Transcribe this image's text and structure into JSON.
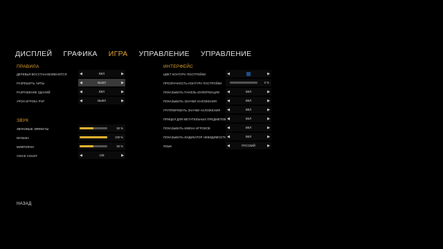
{
  "tabs": [
    "ДИСПЛЕЙ",
    "ГРАФИКА",
    "ИГРА",
    "УПРАВЛЕНИЕ",
    "УПРАВЛЕНИЕ"
  ],
  "active_tab_index": 2,
  "accent_color": "#e8a934",
  "rules": {
    "title": "ПРАВИЛА",
    "items": [
      {
        "label": "ДЕРЕВЬЯ ВОССТАНАВЛИВАЮТСЯ",
        "value": "ВКЛ"
      },
      {
        "label": "РАЗРЕШИТЬ ЧИТЫ",
        "value": "ВЫКЛ"
      },
      {
        "label": "РАЗРУШЕНИЕ ЗДАНИЙ",
        "value": "ВКЛ"
      },
      {
        "label": "УРОН ИГРОКА PVP",
        "value": "ВЫКЛ"
      }
    ]
  },
  "sound": {
    "title": "ЗВУК",
    "items": [
      {
        "label": "ЗВУКОВЫЕ ЭФФЕКТЫ",
        "value": "50 %",
        "level": 0.5
      },
      {
        "label": "МУЗЫКА",
        "value": "100 %",
        "level": 1.0
      },
      {
        "label": "МИКРОФОН",
        "value": "50 %",
        "level": 0.5
      }
    ],
    "voice_count": {
      "label": "VOICE COUNT",
      "value": "128"
    }
  },
  "interface": {
    "title": "ИНТЕРФЕЙС",
    "outline_color": {
      "label": "ЦВЕТ КОНТУРА ПОСТРОЙКИ",
      "color": "#1d4e8a"
    },
    "outline_opacity": {
      "label": "ПРОЗРАЧНОСТЬ КОНТУРА ПОСТРОЙКИ",
      "value": "0 %",
      "level": 0
    },
    "items": [
      {
        "label": "ПОКАЗЫВАТЬ ПАНЕЛЬ ИНФОРМАЦИИ",
        "value": "ВКЛ"
      },
      {
        "label": "ПОКАЗЫВАТЬ ЗНАЧКИ НАЛОЖЕНИЯ",
        "value": "ВКЛ"
      },
      {
        "label": "ГРУППИРОВАТЬ ЗНАЧКИ НАЛОЖЕНИЯ",
        "value": "ВКЛ"
      },
      {
        "label": "ПРИЦЕЛ ДЛЯ МЕТАТЕЛЬНЫХ ПРЕДМЕТОВ",
        "value": "ВКЛ"
      },
      {
        "label": "ПОКАЗЫВАТЬ ИМЕНА ИГРОКОВ",
        "value": "ВКЛ"
      },
      {
        "label": "ПОКАЗЫВАТЬ ИНДИКАТОР НЕВИДИМОСТИ",
        "value": "ВКЛ"
      },
      {
        "label": "ЯЗЫК",
        "value": "РУССКИЙ"
      }
    ]
  },
  "back_label": "НАЗАД"
}
